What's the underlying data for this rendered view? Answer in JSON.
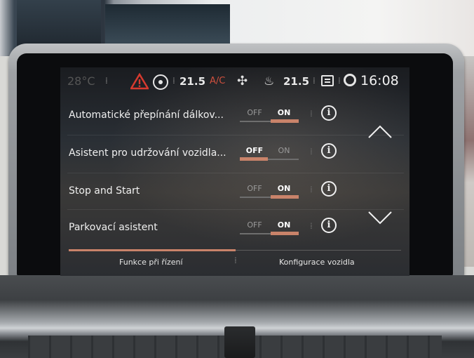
{
  "status_bar": {
    "outside_temp": "28°C",
    "temp_left": "21.5",
    "ac_label": "A/C",
    "temp_right": "21.5",
    "clock": "16:08"
  },
  "settings": [
    {
      "label": "Automatické přepínání dálkov...",
      "off_label": "OFF",
      "on_label": "ON",
      "state": "ON"
    },
    {
      "label": "Asistent pro udržování vozidla...",
      "off_label": "OFF",
      "on_label": "ON",
      "state": "OFF"
    },
    {
      "label": "Stop and Start",
      "off_label": "OFF",
      "on_label": "ON",
      "state": "ON"
    },
    {
      "label": "Parkovací asistent",
      "off_label": "OFF",
      "on_label": "ON",
      "state": "ON"
    }
  ],
  "tabs": {
    "driving_functions": "Funkce při řízení",
    "vehicle_config": "Konfigurace vozidla"
  },
  "icons": {
    "info_glyph": "i",
    "warning": "warning-triangle-icon",
    "fan": "fan-icon",
    "seat": "seat-heat-icon",
    "settings": "gear-icon"
  },
  "colors": {
    "accent": "#c9836a",
    "warning": "#d63a2f"
  }
}
